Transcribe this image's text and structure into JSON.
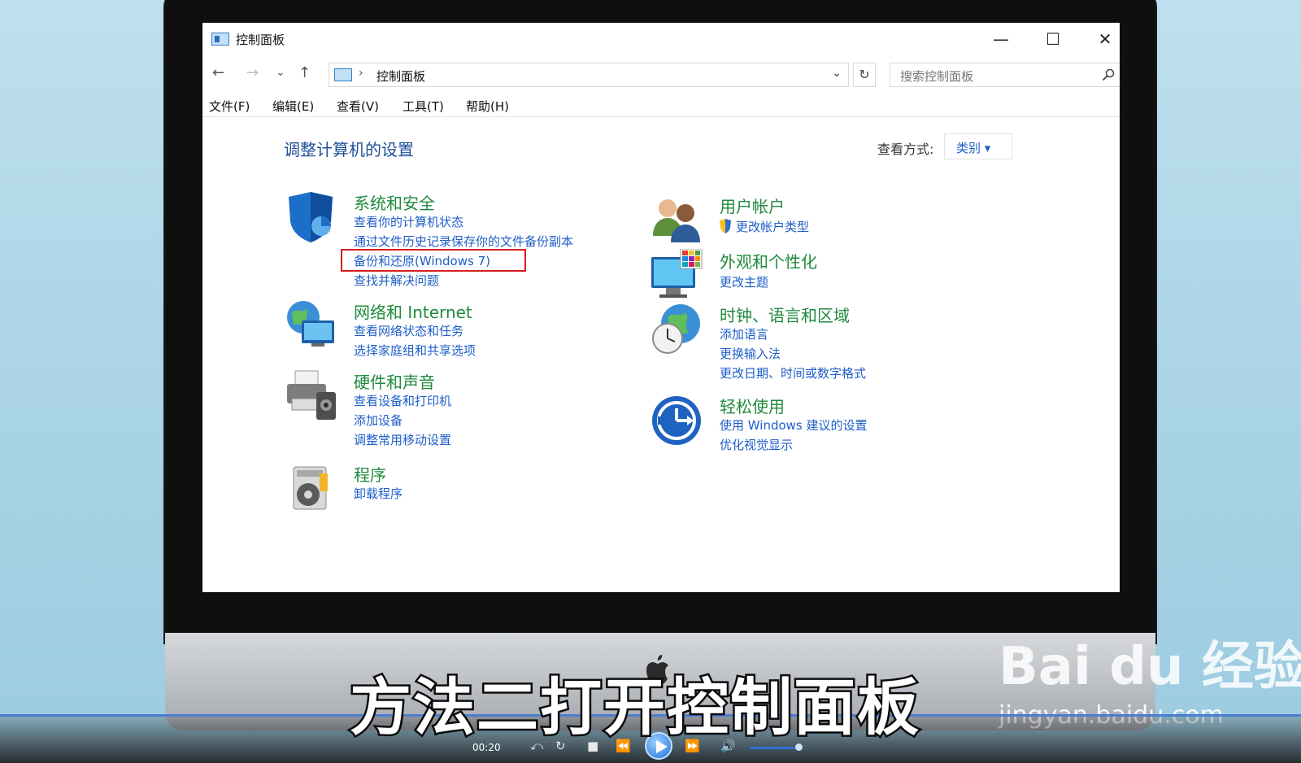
{
  "window": {
    "title": "控制面板",
    "minimize": "—",
    "maximize": "☐",
    "close": "✕"
  },
  "nav": {
    "back": "←",
    "forward": "→",
    "recent": "⌄",
    "up": "↑",
    "address_separator": "›",
    "address": "控制面板",
    "address_dropdown": "⌄",
    "refresh": "↻",
    "search_placeholder": "搜索控制面板"
  },
  "menu": [
    "文件(F)",
    "编辑(E)",
    "查看(V)",
    "工具(T)",
    "帮助(H)"
  ],
  "main": {
    "heading": "调整计算机的设置",
    "view_by_label": "查看方式:",
    "view_by_value": "类别 ▾"
  },
  "categories": {
    "system_security": {
      "title": "系统和安全",
      "links": [
        "查看你的计算机状态",
        "通过文件历史记录保存你的文件备份副本",
        "备份和还原(Windows 7)",
        "查找并解决问题"
      ]
    },
    "network": {
      "title": "网络和 Internet",
      "links": [
        "查看网络状态和任务",
        "选择家庭组和共享选项"
      ]
    },
    "hardware": {
      "title": "硬件和声音",
      "links": [
        "查看设备和打印机",
        "添加设备",
        "调整常用移动设置"
      ]
    },
    "programs": {
      "title": "程序",
      "links": [
        "卸载程序"
      ]
    },
    "user_accounts": {
      "title": "用户帐户",
      "links": [
        "更改帐户类型"
      ]
    },
    "appearance": {
      "title": "外观和个性化",
      "links": [
        "更改主题"
      ]
    },
    "clock_region": {
      "title": "时钟、语言和区域",
      "links": [
        "添加语言",
        "更换输入法",
        "更改日期、时间或数字格式"
      ]
    },
    "ease_of_access": {
      "title": "轻松使用",
      "links": [
        "使用 Windows 建议的设置",
        "优化视觉显示"
      ]
    }
  },
  "overlay": {
    "subtitle": "方法二打开控制面板",
    "watermark_logo": "Bai du 经验",
    "watermark_url": "jingyan.baidu.com"
  },
  "player": {
    "time": "00:20",
    "buttons": [
      "⤺",
      "↻",
      "■",
      "⏪",
      "⏩",
      "🔊"
    ],
    "volume_fraction": 0.85
  },
  "colors": {
    "category_title": "#1f8a3c",
    "link": "#1e5ec8",
    "heading": "#1e4f9a",
    "highlight_box": "#d61e1e"
  }
}
